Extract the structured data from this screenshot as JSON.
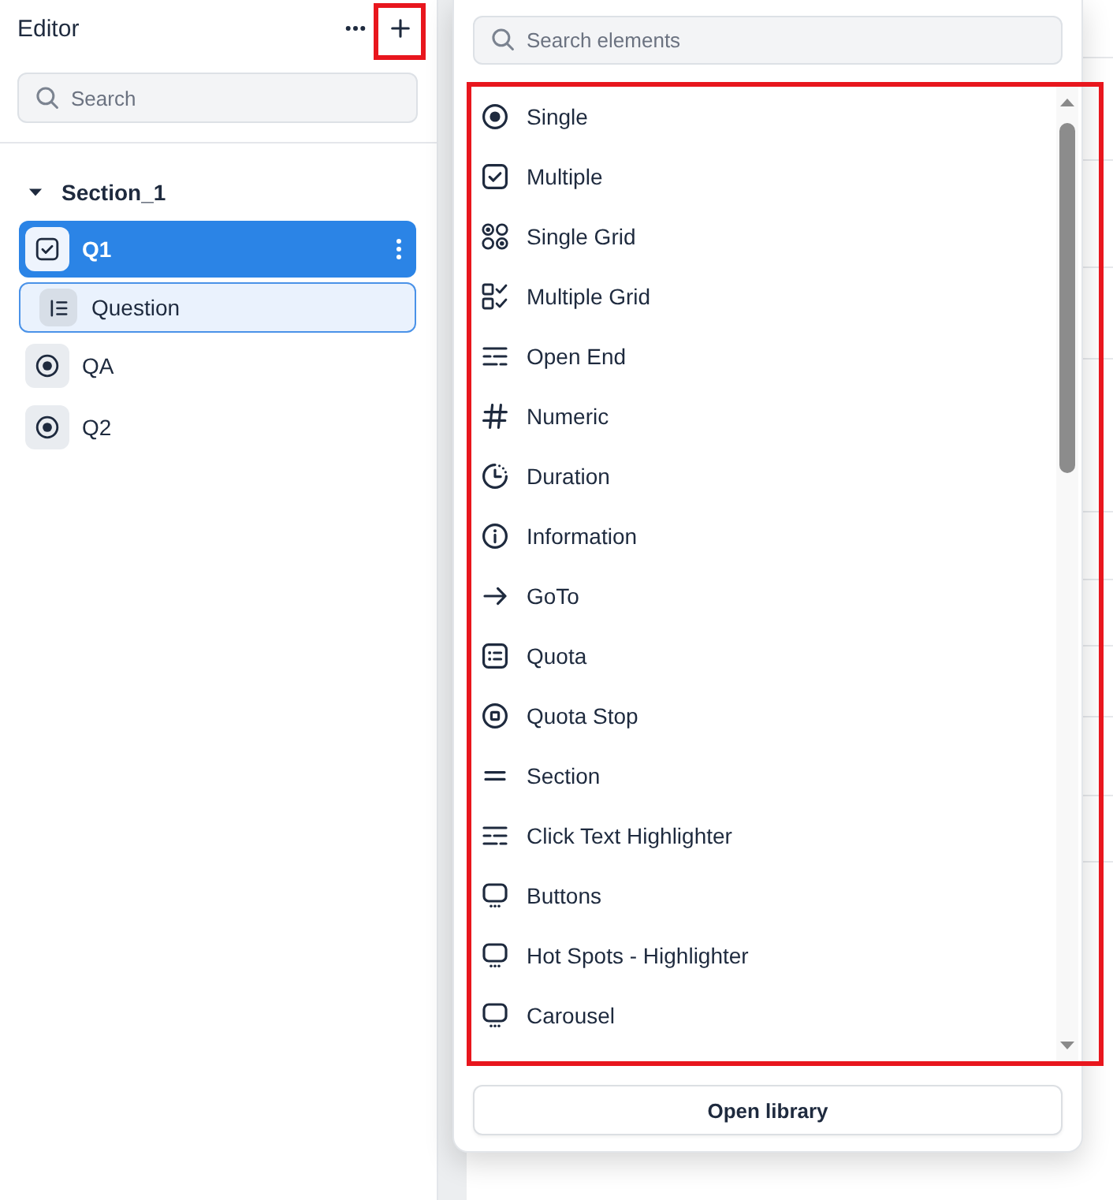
{
  "sidebar": {
    "title": "Editor",
    "add_button": {
      "highlighted": true
    },
    "search": {
      "placeholder": "Search"
    },
    "tree": [
      {
        "label": "Section_1",
        "expanded": true,
        "children": [
          {
            "label": "Q1",
            "kind": "multiple",
            "selected": true,
            "children": [
              {
                "label": "Question",
                "kind": "question",
                "selected": true
              }
            ]
          },
          {
            "label": "QA",
            "kind": "single",
            "selected": false
          },
          {
            "label": "Q2",
            "kind": "single",
            "selected": false
          }
        ]
      }
    ]
  },
  "element_picker": {
    "search": {
      "placeholder": "Search elements"
    },
    "highlighted": true,
    "items": [
      {
        "label": "Single",
        "kind": "single"
      },
      {
        "label": "Multiple",
        "kind": "multiple"
      },
      {
        "label": "Single Grid",
        "kind": "single_grid"
      },
      {
        "label": "Multiple Grid",
        "kind": "multiple_grid"
      },
      {
        "label": "Open End",
        "kind": "open_end"
      },
      {
        "label": "Numeric",
        "kind": "numeric"
      },
      {
        "label": "Duration",
        "kind": "duration"
      },
      {
        "label": "Information",
        "kind": "information"
      },
      {
        "label": "GoTo",
        "kind": "goto"
      },
      {
        "label": "Quota",
        "kind": "quota"
      },
      {
        "label": "Quota Stop",
        "kind": "quota_stop"
      },
      {
        "label": "Section",
        "kind": "section"
      },
      {
        "label": "Click Text Highlighter",
        "kind": "click_text_highlighter"
      },
      {
        "label": "Buttons",
        "kind": "buttons"
      },
      {
        "label": "Hot Spots - Highlighter",
        "kind": "hot_spots"
      },
      {
        "label": "Carousel",
        "kind": "carousel"
      }
    ],
    "button": "Open library"
  }
}
